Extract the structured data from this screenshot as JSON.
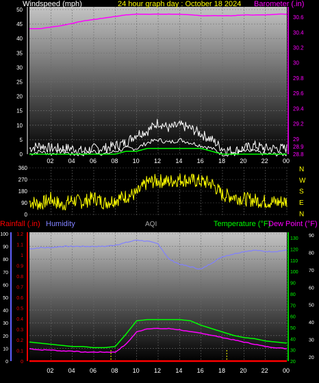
{
  "header": {
    "windspeed_label": "Windspeed (mph)",
    "title": "24 hour graph day : October 18 2024",
    "barometer_label": "Barometer (.in)"
  },
  "lower_header": {
    "rainfall_label": "Rainfall (.in)",
    "humidity_label": "Humidity",
    "aqi_label": "AQI",
    "temperature_label": "Temperature (°F)",
    "dewpoint_label": "Dew Point (°F)"
  },
  "colors": {
    "windspeed": "#ffffff",
    "windgust": "#ffffff",
    "wind_avg": "#00ff00",
    "barometer": "#ff00ff",
    "direction": "#ffff00",
    "rainfall": "#ff0000",
    "humidity": "#8080ff",
    "temperature": "#00ff00",
    "dewpoint": "#ff00ff",
    "rain_day_marker": "#ffff00",
    "title": "#ffff00",
    "left_axis_upper": "#ffffff",
    "right_axis_green": "#00ff00"
  },
  "chart_data": [
    {
      "type": "line",
      "name": "wind-barometer",
      "x_ticks": [
        "02",
        "04",
        "06",
        "08",
        "10",
        "12",
        "14",
        "16",
        "18",
        "20",
        "22",
        "00"
      ],
      "x": [
        0,
        1,
        2,
        3,
        4,
        5,
        6,
        7,
        8,
        9,
        10,
        11,
        12,
        13,
        14,
        15,
        16,
        17,
        18,
        19,
        20,
        21,
        22,
        23,
        24
      ],
      "left_axis": {
        "label": "Windspeed (mph)",
        "ticks": [
          "0",
          "5",
          "10",
          "15",
          "20",
          "25",
          "30",
          "35",
          "40",
          "45",
          "50"
        ],
        "ylim": [
          0,
          50
        ]
      },
      "right_axis": {
        "label": "Barometer (.in)",
        "ticks": [
          "28.8",
          "28.9",
          "29",
          "29.2",
          "29.4",
          "29.6",
          "29.8",
          "30",
          "30.2",
          "30.4",
          "30.6"
        ],
        "ylim": [
          28.8,
          30.7
        ]
      },
      "series": [
        {
          "values": [
            0,
            1,
            0,
            1,
            0,
            0,
            1,
            0,
            1,
            2,
            2,
            4,
            5,
            4,
            5,
            4,
            3,
            2,
            0,
            0,
            1,
            1,
            0,
            0,
            0
          ]
        },
        {
          "values": [
            2,
            3,
            2,
            2,
            2,
            1,
            2,
            2,
            3,
            4,
            7,
            8,
            11,
            9,
            10,
            9,
            7,
            5,
            2,
            1,
            2,
            3,
            2,
            2,
            2
          ]
        },
        {
          "values": [
            0,
            0,
            0,
            0,
            0,
            0,
            0,
            0,
            0,
            1,
            1,
            2,
            2,
            2,
            2,
            2,
            2,
            1,
            0,
            0,
            0,
            0,
            0,
            0,
            0
          ]
        },
        {
          "values": [
            30.45,
            30.45,
            30.47,
            30.49,
            30.52,
            30.55,
            30.57,
            30.59,
            30.61,
            30.63,
            30.64,
            30.64,
            30.64,
            30.64,
            30.64,
            30.63,
            30.62,
            30.62,
            30.62,
            30.62,
            30.63,
            30.63,
            30.63,
            30.64,
            30.64
          ]
        }
      ]
    },
    {
      "type": "line",
      "name": "wind-direction",
      "left_axis": {
        "ticks": [
          "0",
          "90",
          "180",
          "270",
          "360"
        ],
        "ylim": [
          0,
          360
        ]
      },
      "right_axis": {
        "ticks": [
          "N",
          "W",
          "S",
          "E",
          "N"
        ]
      },
      "series": [
        {
          "values": [
            100,
            80,
            120,
            70,
            110,
            95,
            130,
            90,
            115,
            140,
            160,
            250,
            260,
            255,
            270,
            265,
            255,
            240,
            150,
            140,
            120,
            110,
            100,
            95,
            100
          ]
        }
      ]
    },
    {
      "type": "line",
      "name": "temp-humidity-rain",
      "x_ticks": [
        "02",
        "04",
        "06",
        "08",
        "10",
        "12",
        "14",
        "16",
        "18",
        "20",
        "22",
        "00"
      ],
      "x": [
        0,
        1,
        2,
        3,
        4,
        5,
        6,
        7,
        8,
        9,
        10,
        11,
        12,
        13,
        14,
        15,
        16,
        17,
        18,
        19,
        20,
        21,
        22,
        23,
        24
      ],
      "left_axis_humidity": {
        "ticks": [
          "0",
          "10",
          "20",
          "30",
          "40",
          "50",
          "60",
          "70",
          "80",
          "90",
          "100"
        ],
        "ylim": [
          0,
          100
        ]
      },
      "left_axis_rain": {
        "ticks": [
          "0",
          "0.1",
          "0.2",
          "0.3",
          "0.4",
          "0.5",
          "0.6",
          "0.7",
          "0.8",
          "0.9",
          "1",
          "1.1",
          "1.2"
        ],
        "ylim": [
          0,
          1.2
        ]
      },
      "right_axis_temperature": {
        "ticks": [
          "20",
          "30",
          "40",
          "50",
          "60",
          "70",
          "80",
          "90",
          "100",
          "110",
          "120",
          "130"
        ],
        "ylim": [
          20,
          135
        ]
      },
      "right_axis_temperature_outer": {
        "ticks": [
          "20",
          "30",
          "40",
          "50",
          "60",
          "70",
          "80",
          "90"
        ]
      },
      "series": [
        {
          "values": [
            88,
            89,
            89,
            90,
            90,
            90,
            90,
            90,
            91,
            93,
            95,
            94,
            92,
            80,
            76,
            74,
            72,
            77,
            82,
            84,
            86,
            87,
            86,
            86,
            87
          ]
        },
        {
          "values": [
            37,
            36,
            35,
            34,
            33,
            33,
            32,
            32,
            33,
            44,
            56,
            57,
            57,
            57,
            57,
            56,
            52,
            49,
            46,
            43,
            41,
            40,
            38,
            37,
            36
          ]
        },
        {
          "values": [
            31,
            30,
            30,
            29,
            29,
            28,
            28,
            28,
            28,
            35,
            46,
            49,
            49,
            49,
            48,
            46,
            45,
            43,
            41,
            39,
            37,
            35,
            33,
            32,
            31
          ]
        },
        {
          "values": [
            0,
            0,
            0,
            0,
            0,
            0,
            0,
            0,
            0,
            0,
            0,
            0,
            0,
            0,
            0,
            0,
            0,
            0,
            0,
            0,
            0,
            0,
            0,
            0,
            0
          ]
        }
      ],
      "rain_day_markers_hours": [
        7.6,
        18.4
      ]
    }
  ]
}
